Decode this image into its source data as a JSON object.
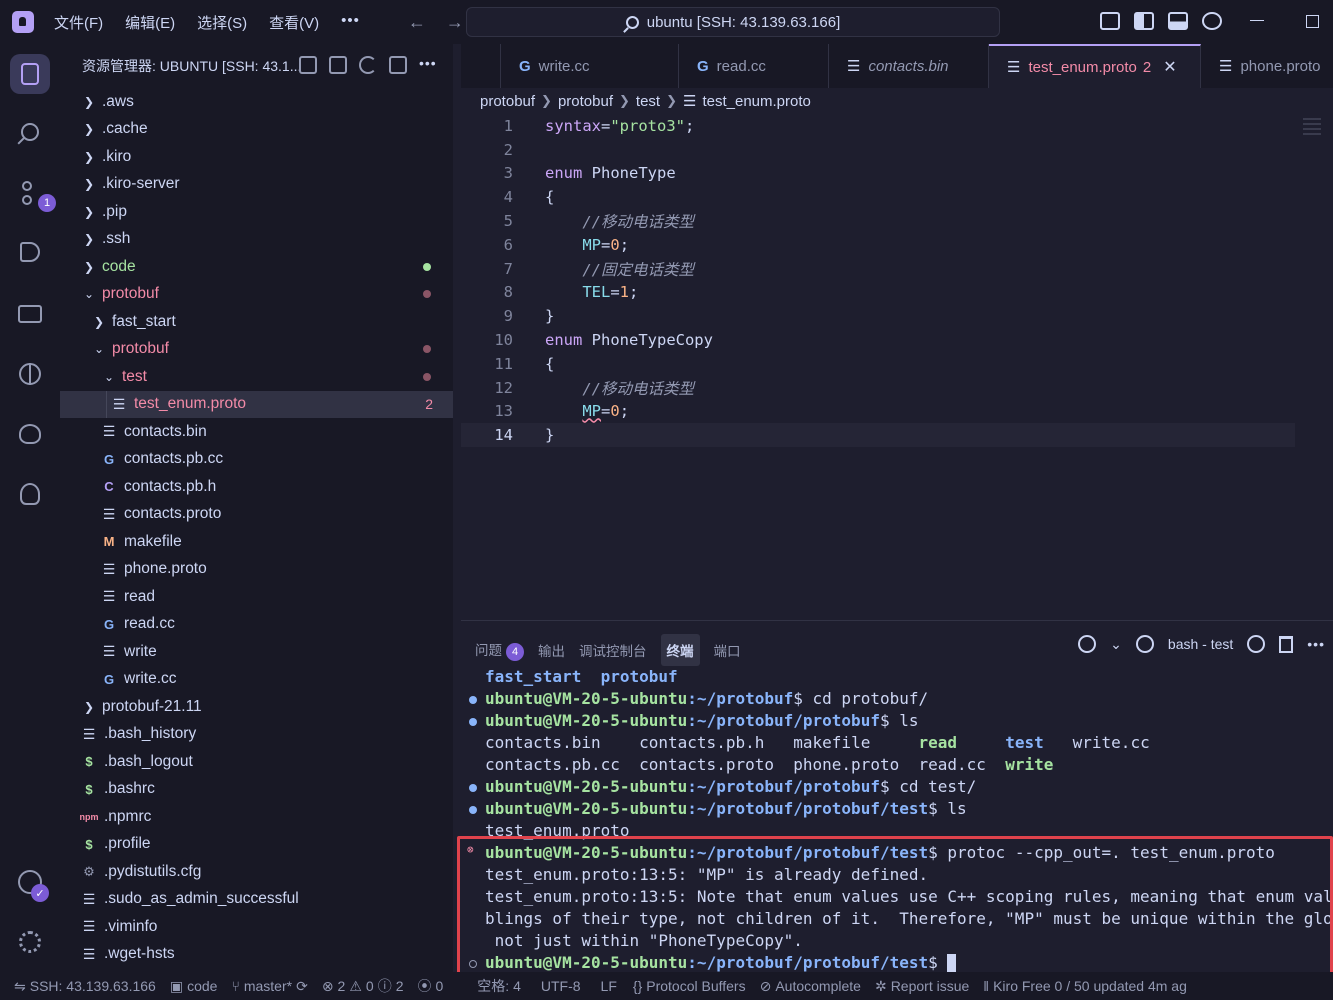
{
  "menu": {
    "file": "文件(F)",
    "edit": "编辑(E)",
    "selection": "选择(S)",
    "view": "查看(V)",
    "more": "•••"
  },
  "command_center": "ubuntu [SSH: 43.139.63.166]",
  "activity": {
    "scm_badge": "1",
    "account_badge": "✓"
  },
  "sidebar": {
    "title": "资源管理器: UBUNTU [SSH: 43.1...",
    "more": "•••",
    "tree": [
      {
        "label": ".aws"
      },
      {
        "label": ".cache"
      },
      {
        "label": ".kiro"
      },
      {
        "label": ".kiro-server"
      },
      {
        "label": ".pip"
      },
      {
        "label": ".ssh"
      },
      {
        "label": "code"
      },
      {
        "label": "protobuf"
      },
      {
        "label": "fast_start"
      },
      {
        "label": "protobuf"
      },
      {
        "label": "test"
      },
      {
        "label": "test_enum.proto",
        "count": "2"
      },
      {
        "label": "contacts.bin"
      },
      {
        "label": "contacts.pb.cc"
      },
      {
        "label": "contacts.pb.h"
      },
      {
        "label": "contacts.proto"
      },
      {
        "label": "makefile"
      },
      {
        "label": "phone.proto"
      },
      {
        "label": "read"
      },
      {
        "label": "read.cc"
      },
      {
        "label": "write"
      },
      {
        "label": "write.cc"
      },
      {
        "label": "protobuf-21.11"
      },
      {
        "label": ".bash_history"
      },
      {
        "label": ".bash_logout"
      },
      {
        "label": ".bashrc"
      },
      {
        "label": ".npmrc"
      },
      {
        "label": ".profile"
      },
      {
        "label": ".pydistutils.cfg"
      },
      {
        "label": ".sudo_as_admin_successful"
      },
      {
        "label": ".viminfo"
      },
      {
        "label": ".wget-hsts"
      }
    ],
    "icons": {
      "npm": "npm",
      "makefile": "M",
      "header": "C",
      "shell": "$"
    }
  },
  "tabs": [
    {
      "label": "write.cc"
    },
    {
      "label": "read.cc"
    },
    {
      "label": "contacts.bin"
    },
    {
      "label": "test_enum.proto",
      "errors": "2"
    },
    {
      "label": "phone.proto"
    }
  ],
  "breadcrumb": [
    "protobuf",
    "protobuf",
    "test",
    "test_enum.proto"
  ],
  "editor": {
    "line_numbers": [
      "1",
      "2",
      "3",
      "4",
      "5",
      "6",
      "7",
      "8",
      "9",
      "10",
      "11",
      "12",
      "13",
      "14"
    ],
    "lines": [
      "syntax=\"proto3\";",
      "",
      "enum PhoneType",
      "{",
      "    //移动电话类型",
      "    MP=0;",
      "    //固定电话类型",
      "    TEL=1;",
      "}",
      "enum PhoneTypeCopy",
      "{",
      "    //移动电话类型",
      "    MP=0;",
      "}"
    ]
  },
  "panel": {
    "tabs": {
      "problems": "问题",
      "problems_count": "4",
      "output": "输出",
      "debug_console": "调试控制台",
      "terminal": "终端",
      "ports": "端口"
    },
    "terminal_name": "bash - test",
    "more": "•••",
    "terminal_lines": {
      "l1a": "fast_start",
      "l1b": "protobuf",
      "prompt": "ubuntu@VM-20-5-ubuntu",
      "p2path": ":~/protobuf",
      "p2cmd": "$ cd protobuf/",
      "p3path": ":~/protobuf/protobuf",
      "p3cmd": "$ ls",
      "ls1": [
        "contacts.bin",
        "contacts.pb.h",
        "makefile",
        "read",
        "test",
        "write.cc"
      ],
      "ls2": [
        "contacts.pb.cc",
        "contacts.proto",
        "phone.proto",
        "read.cc",
        "write"
      ],
      "p4path": ":~/protobuf/protobuf",
      "p4cmd": "$ cd test/",
      "p5path": ":~/protobuf/protobuf/test",
      "p5cmd": "$ ls",
      "ls3": "test_enum.proto",
      "p6path": ":~/protobuf/protobuf/test",
      "p6cmd": "$ protoc --cpp_out=. test_enum.proto",
      "err1": "test_enum.proto:13:5: \"MP\" is already defined.",
      "err2": "test_enum.proto:13:5: Note that enum values use C++ scoping rules, meaning that enum values ar",
      "err3": "blings of their type, not children of it.  Therefore, \"MP\" must be unique within the global sc",
      "err4": " not just within \"PhoneTypeCopy\".",
      "p7path": ":~/protobuf/protobuf/test",
      "p7cmd": "$ "
    }
  },
  "statusbar": {
    "remote": "SSH: 43.139.63.166",
    "folder": "code",
    "branch": "master*",
    "errors": "2",
    "warnings": "0",
    "info": "2",
    "ports": "0",
    "spaces": "空格: 4",
    "encoding": "UTF-8",
    "eol": "LF",
    "language": "Protocol Buffers",
    "autocomplete": "Autocomplete",
    "report": "Report issue",
    "kiro": "Kiro Free 0 / 50 updated 4m ag"
  },
  "colors": {
    "accent": "#b4a0f5",
    "error": "#f38ba8",
    "highlight_box": "#e0434c"
  }
}
